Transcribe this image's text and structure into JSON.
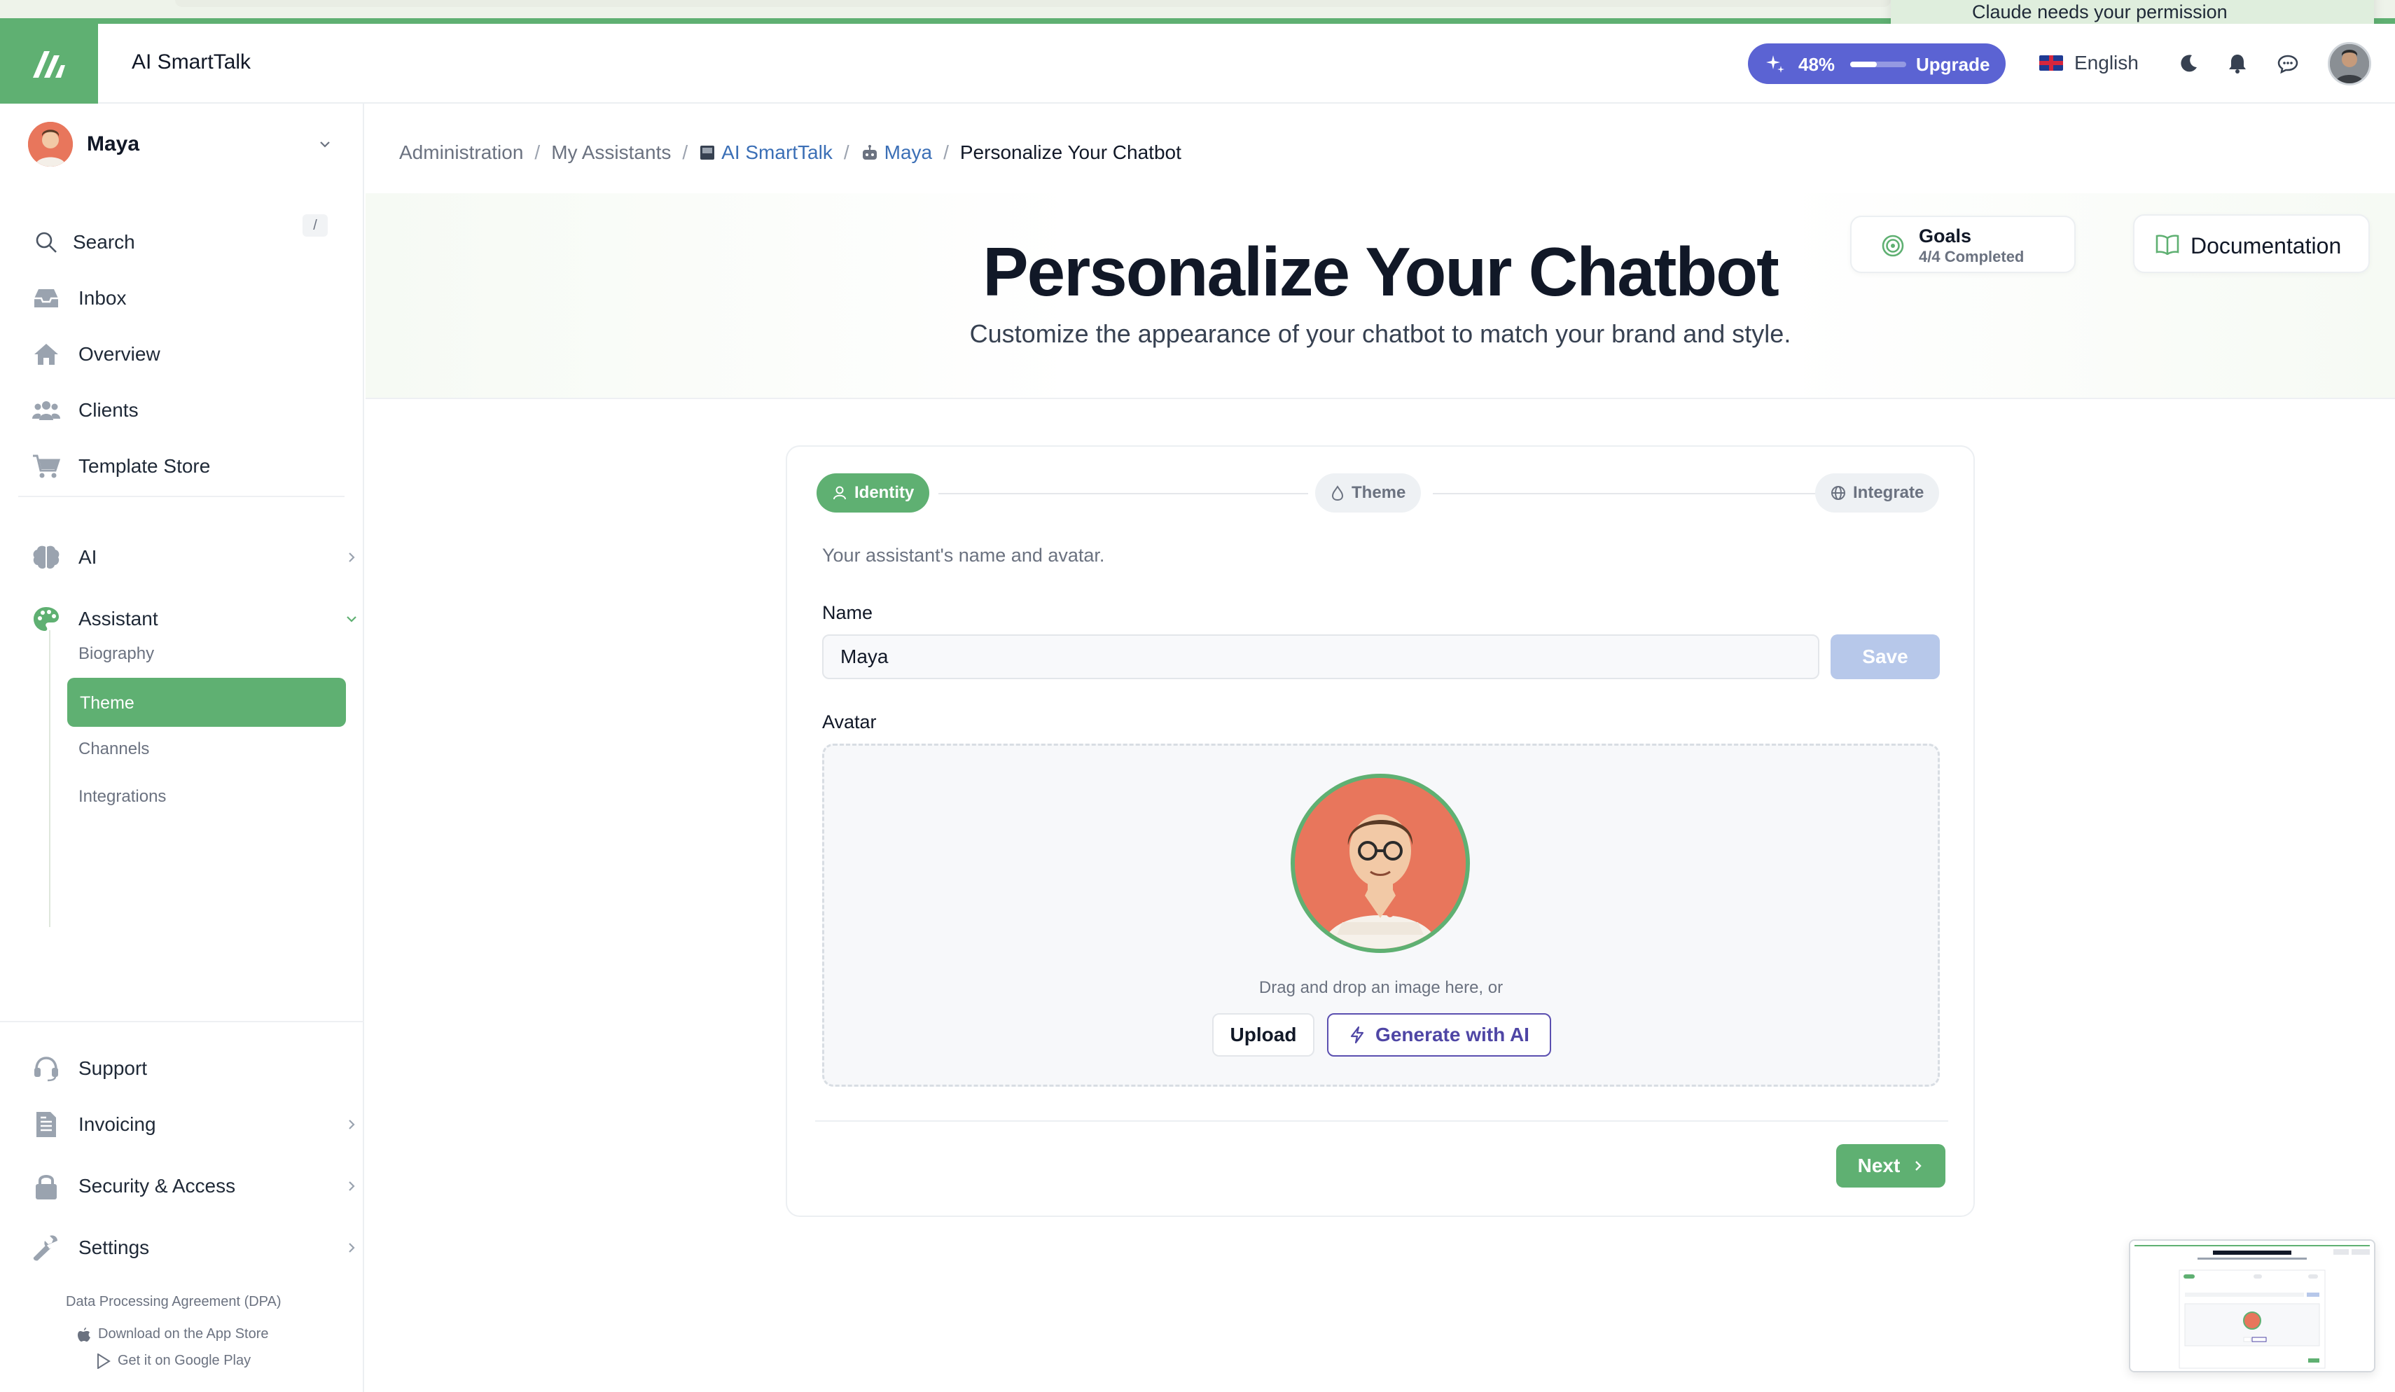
{
  "app": {
    "title": "AI SmartTalk"
  },
  "notification": {
    "text": "Claude needs your permission"
  },
  "header": {
    "usage_percent": "48%",
    "usage_fraction": 0.48,
    "upgrade_label": "Upgrade",
    "language": "English",
    "icons": [
      "sparkles-icon",
      "moon-icon",
      "bell-icon",
      "chat-icon"
    ]
  },
  "sidebar": {
    "user_name": "Maya",
    "search_label": "Search",
    "search_shortcut": "/",
    "items": [
      {
        "label": "Inbox",
        "icon": "inbox-icon"
      },
      {
        "label": "Overview",
        "icon": "home-icon"
      },
      {
        "label": "Clients",
        "icon": "users-icon"
      },
      {
        "label": "Template Store",
        "icon": "cart-icon"
      }
    ],
    "ai_label": "AI",
    "assistant_label": "Assistant",
    "assistant_sub": [
      "Biography",
      "Theme",
      "Channels",
      "Integrations"
    ],
    "bottom": [
      {
        "label": "Support",
        "icon": "headset-icon"
      },
      {
        "label": "Invoicing",
        "icon": "invoice-icon"
      },
      {
        "label": "Security & Access",
        "icon": "lock-icon"
      },
      {
        "label": "Settings",
        "icon": "wrench-icon"
      }
    ],
    "dpa": "Data Processing Agreement (DPA)",
    "app_store": "Download on the App Store",
    "google_play": "Get it on Google Play"
  },
  "breadcrumb": [
    "Administration",
    "My Assistants",
    "AI SmartTalk",
    "Maya",
    "Personalize Your Chatbot"
  ],
  "hero": {
    "title": "Personalize Your Chatbot",
    "subtitle": "Customize the appearance of your chatbot to match your brand and style."
  },
  "goals": {
    "label": "Goals",
    "status": "4/4 Completed"
  },
  "documentation_label": "Documentation",
  "wizard": {
    "steps": [
      "Identity",
      "Theme",
      "Integrate"
    ],
    "active_step": "Identity",
    "description": "Your assistant's name and avatar.",
    "name_label": "Name",
    "name_value": "Maya",
    "save_label": "Save",
    "avatar_label": "Avatar",
    "drop_text": "Drag and drop an image here, or",
    "upload_label": "Upload",
    "generate_label": "Generate with AI",
    "next_label": "Next"
  },
  "colors": {
    "brand_green": "#5fb072",
    "upgrade_purple": "#5b63d3",
    "link_blue": "#3b6fb6",
    "save_disabled": "#b7c8ea"
  }
}
